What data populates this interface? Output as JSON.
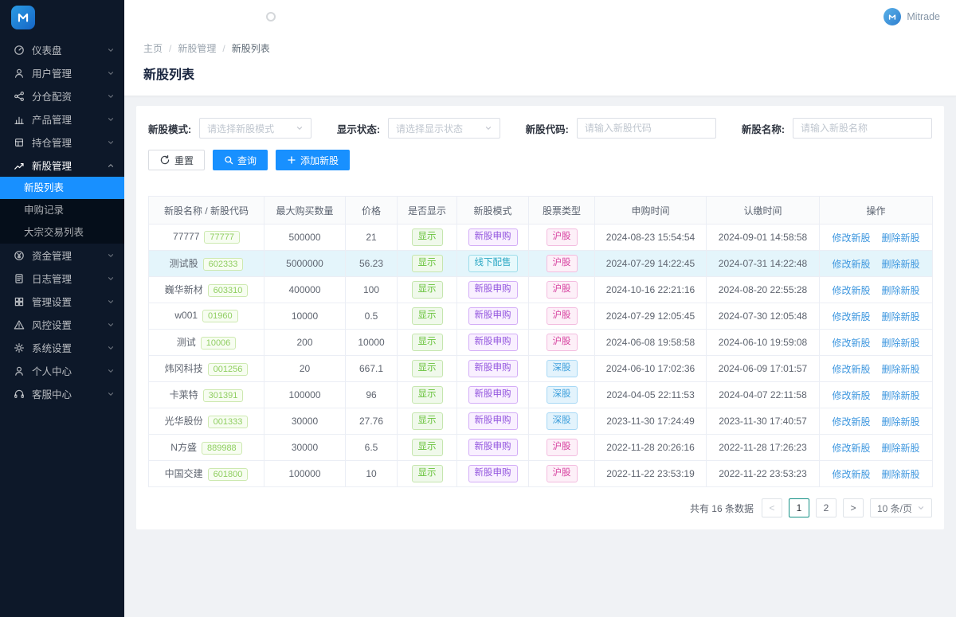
{
  "header": {
    "user_name": "Mitrade"
  },
  "sidebar": {
    "items": [
      {
        "label": "仪表盘",
        "icon": "dashboard-icon",
        "state": "collapsed"
      },
      {
        "label": "用户管理",
        "icon": "users-icon",
        "state": "collapsed"
      },
      {
        "label": "分仓配资",
        "icon": "share-icon",
        "state": "collapsed"
      },
      {
        "label": "产品管理",
        "icon": "chart-icon",
        "state": "collapsed"
      },
      {
        "label": "持仓管理",
        "icon": "layers-icon",
        "state": "collapsed"
      },
      {
        "label": "新股管理",
        "icon": "trend-icon",
        "state": "expanded",
        "children": [
          {
            "label": "新股列表",
            "active": true
          },
          {
            "label": "申购记录",
            "active": false
          },
          {
            "label": "大宗交易列表",
            "active": false
          }
        ]
      },
      {
        "label": "资金管理",
        "icon": "money-icon",
        "state": "collapsed"
      },
      {
        "label": "日志管理",
        "icon": "log-icon",
        "state": "collapsed"
      },
      {
        "label": "管理设置",
        "icon": "grid-icon",
        "state": "collapsed"
      },
      {
        "label": "风控设置",
        "icon": "warning-icon",
        "state": "collapsed"
      },
      {
        "label": "系统设置",
        "icon": "gear-icon",
        "state": "collapsed"
      },
      {
        "label": "个人中心",
        "icon": "user-icon",
        "state": "collapsed"
      },
      {
        "label": "客服中心",
        "icon": "headset-icon",
        "state": "collapsed"
      }
    ]
  },
  "breadcrumb": {
    "items": [
      "主页",
      "新股管理",
      "新股列表"
    ],
    "separator": "/"
  },
  "page": {
    "title": "新股列表"
  },
  "filters": [
    {
      "label": "新股模式:",
      "type": "select",
      "placeholder": "请选择新股模式"
    },
    {
      "label": "显示状态:",
      "type": "select",
      "placeholder": "请选择显示状态"
    },
    {
      "label": "新股代码:",
      "type": "input",
      "placeholder": "请输入新股代码"
    },
    {
      "label": "新股名称:",
      "type": "input",
      "placeholder": "请输入新股名称"
    }
  ],
  "toolbar": {
    "reset_label": "重置",
    "search_label": "查询",
    "add_label": "添加新股"
  },
  "table": {
    "columns": [
      "新股名称 / 新股代码",
      "最大购买数量",
      "价格",
      "是否显示",
      "新股模式",
      "股票类型",
      "申购时间",
      "认缴时间",
      "操作"
    ],
    "action_labels": [
      "修改新股",
      "删除新股"
    ],
    "highlight_row_index": 1,
    "rows": [
      {
        "name": "77777",
        "code": "77777",
        "max_qty": "500000",
        "price": "21",
        "visible": "显示",
        "mode": "新股申购",
        "mode_color": "purple",
        "market": "沪股",
        "market_color": "magenta",
        "apply_time": "2024-08-23 15:54:54",
        "confirm_time": "2024-09-01 14:58:58"
      },
      {
        "name": "测试股",
        "code": "602333",
        "max_qty": "5000000",
        "price": "56.23",
        "visible": "显示",
        "mode": "线下配售",
        "mode_color": "cyan",
        "market": "沪股",
        "market_color": "magenta",
        "apply_time": "2024-07-29 14:22:45",
        "confirm_time": "2024-07-31 14:22:48"
      },
      {
        "name": "巍华新材",
        "code": "603310",
        "max_qty": "400000",
        "price": "100",
        "visible": "显示",
        "mode": "新股申购",
        "mode_color": "purple",
        "market": "沪股",
        "market_color": "magenta",
        "apply_time": "2024-10-16 22:21:16",
        "confirm_time": "2024-08-20 22:55:28"
      },
      {
        "name": "w001",
        "code": "01960",
        "max_qty": "10000",
        "price": "0.5",
        "visible": "显示",
        "mode": "新股申购",
        "mode_color": "purple",
        "market": "沪股",
        "market_color": "magenta",
        "apply_time": "2024-07-29 12:05:45",
        "confirm_time": "2024-07-30 12:05:48"
      },
      {
        "name": "测试",
        "code": "10006",
        "max_qty": "200",
        "price": "10000",
        "visible": "显示",
        "mode": "新股申购",
        "mode_color": "purple",
        "market": "沪股",
        "market_color": "magenta",
        "apply_time": "2024-06-08 19:58:58",
        "confirm_time": "2024-06-10 19:59:08"
      },
      {
        "name": "炜冈科技",
        "code": "001256",
        "max_qty": "20",
        "price": "667.1",
        "visible": "显示",
        "mode": "新股申购",
        "mode_color": "purple",
        "market": "深股",
        "market_color": "blue",
        "apply_time": "2024-06-10 17:02:36",
        "confirm_time": "2024-06-09 17:01:57"
      },
      {
        "name": "卡莱特",
        "code": "301391",
        "max_qty": "100000",
        "price": "96",
        "visible": "显示",
        "mode": "新股申购",
        "mode_color": "purple",
        "market": "深股",
        "market_color": "blue",
        "apply_time": "2024-04-05 22:11:53",
        "confirm_time": "2024-04-07 22:11:58"
      },
      {
        "name": "光华股份",
        "code": "001333",
        "max_qty": "30000",
        "price": "27.76",
        "visible": "显示",
        "mode": "新股申购",
        "mode_color": "purple",
        "market": "深股",
        "market_color": "blue",
        "apply_time": "2023-11-30 17:24:49",
        "confirm_time": "2023-11-30 17:40:57"
      },
      {
        "name": "N方盛",
        "code": "889988",
        "max_qty": "30000",
        "price": "6.5",
        "visible": "显示",
        "mode": "新股申购",
        "mode_color": "purple",
        "market": "沪股",
        "market_color": "magenta",
        "apply_time": "2022-11-28 20:26:16",
        "confirm_time": "2022-11-28 17:26:23"
      },
      {
        "name": "中国交建",
        "code": "601800",
        "max_qty": "100000",
        "price": "10",
        "visible": "显示",
        "mode": "新股申购",
        "mode_color": "purple",
        "market": "沪股",
        "market_color": "magenta",
        "apply_time": "2022-11-22 23:53:19",
        "confirm_time": "2022-11-22 23:53:23"
      }
    ]
  },
  "pagination": {
    "total_text": "共有 16 条数据",
    "prev": "<",
    "next": ">",
    "pages": [
      "1",
      "2"
    ],
    "active_page": "1",
    "page_size_label": "10 条/页"
  },
  "colors": {
    "accent": "#1890ff",
    "sidebar_bg": "#0d1829",
    "active_page_border": "#169186"
  }
}
